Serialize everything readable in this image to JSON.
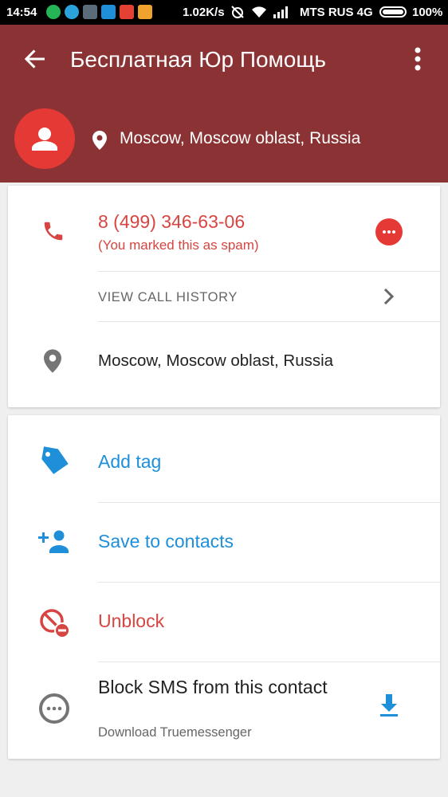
{
  "status_bar": {
    "time": "14:54",
    "speed": "1.02K/s",
    "carrier": "MTS RUS 4G",
    "battery": "100%"
  },
  "header": {
    "title": "Бесплатная Юр Помощь",
    "location": "Moscow, Moscow oblast, Russia",
    "background": "#8b3234",
    "avatar_color": "#e53935"
  },
  "details": {
    "phone_number": "8 (499) 346-63-06",
    "spam_note": "(You marked this as spam)",
    "view_history_label": "VIEW CALL HISTORY",
    "location": "Moscow, Moscow oblast, Russia"
  },
  "actions": {
    "add_tag": "Add tag",
    "save_contacts": "Save to contacts",
    "unblock": "Unblock",
    "block_sms_title": "Block SMS from this contact",
    "block_sms_sub": "Download Truemessenger"
  },
  "colors": {
    "accent_red": "#d64541",
    "accent_blue": "#1e8fd8"
  },
  "icons": [
    "back-arrow-icon",
    "more-vert-icon",
    "person-icon",
    "location-pin-icon",
    "phone-icon",
    "message-icon",
    "chevron-right-icon",
    "tag-icon",
    "add-person-icon",
    "unblock-icon",
    "sms-icon",
    "download-icon"
  ]
}
